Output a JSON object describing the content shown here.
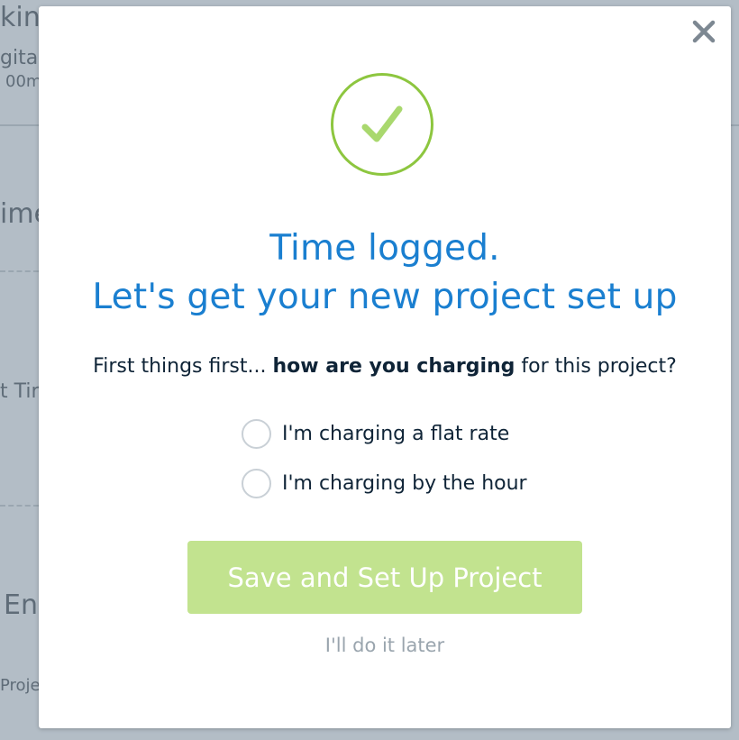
{
  "background": {
    "fragments": [
      "kin",
      "gita",
      "00m",
      "ime",
      "t Tir",
      "En",
      "Proje"
    ]
  },
  "modal": {
    "close_icon": "close-icon",
    "check_icon": "checkmark-icon",
    "title_line1": "Time logged.",
    "title_line2": "Let's get your new project set up",
    "question_prefix": "First things first... ",
    "question_bold": "how are you charging",
    "question_suffix": " for this project?",
    "options": [
      {
        "label": "I'm charging a flat rate",
        "selected": false
      },
      {
        "label": "I'm charging by the hour",
        "selected": false
      }
    ],
    "primary_button": "Save and Set Up Project",
    "secondary_link": "I'll do it later",
    "colors": {
      "accent_blue": "#1a7fd0",
      "check_green": "#8dc63f",
      "button_green_disabled": "#c2e38f"
    }
  }
}
